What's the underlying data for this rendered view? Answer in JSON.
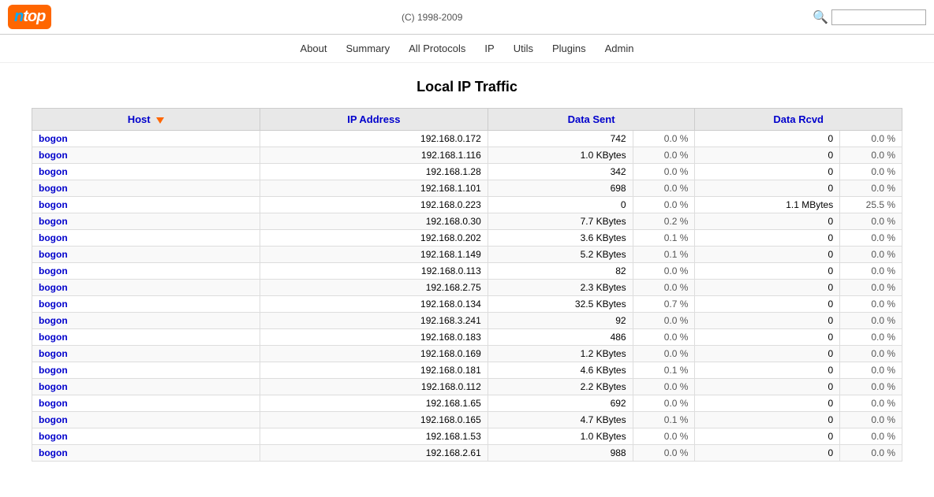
{
  "header": {
    "logo_text": "ntop",
    "copyright": "(C) 1998-2009"
  },
  "nav": {
    "items": [
      {
        "label": "About",
        "id": "about"
      },
      {
        "label": "Summary",
        "id": "summary"
      },
      {
        "label": "All Protocols",
        "id": "all-protocols"
      },
      {
        "label": "IP",
        "id": "ip"
      },
      {
        "label": "Utils",
        "id": "utils"
      },
      {
        "label": "Plugins",
        "id": "plugins"
      },
      {
        "label": "Admin",
        "id": "admin"
      }
    ]
  },
  "page_title": "Local IP Traffic",
  "table": {
    "columns": [
      "Host",
      "IP Address",
      "Data Sent",
      "",
      "Data Rcvd",
      ""
    ],
    "header_row": {
      "host": "Host",
      "ip_address": "IP Address",
      "data_sent": "Data Sent",
      "data_rcvd": "Data Rcvd"
    },
    "rows": [
      {
        "host": "bogon",
        "ip": "192.168.0.172",
        "sent": "742",
        "sent_pct": "0.0 %",
        "rcvd": "0",
        "rcvd_pct": "0.0 %"
      },
      {
        "host": "bogon",
        "ip": "192.168.1.116",
        "sent": "1.0 KBytes",
        "sent_pct": "0.0 %",
        "rcvd": "0",
        "rcvd_pct": "0.0 %"
      },
      {
        "host": "bogon",
        "ip": "192.168.1.28",
        "sent": "342",
        "sent_pct": "0.0 %",
        "rcvd": "0",
        "rcvd_pct": "0.0 %"
      },
      {
        "host": "bogon",
        "ip": "192.168.1.101",
        "sent": "698",
        "sent_pct": "0.0 %",
        "rcvd": "0",
        "rcvd_pct": "0.0 %"
      },
      {
        "host": "bogon",
        "ip": "192.168.0.223",
        "sent": "0",
        "sent_pct": "0.0 %",
        "rcvd": "1.1 MBytes",
        "rcvd_pct": "25.5 %"
      },
      {
        "host": "bogon",
        "ip": "192.168.0.30",
        "sent": "7.7 KBytes",
        "sent_pct": "0.2 %",
        "rcvd": "0",
        "rcvd_pct": "0.0 %"
      },
      {
        "host": "bogon",
        "ip": "192.168.0.202",
        "sent": "3.6 KBytes",
        "sent_pct": "0.1 %",
        "rcvd": "0",
        "rcvd_pct": "0.0 %"
      },
      {
        "host": "bogon",
        "ip": "192.168.1.149",
        "sent": "5.2 KBytes",
        "sent_pct": "0.1 %",
        "rcvd": "0",
        "rcvd_pct": "0.0 %"
      },
      {
        "host": "bogon",
        "ip": "192.168.0.113",
        "sent": "82",
        "sent_pct": "0.0 %",
        "rcvd": "0",
        "rcvd_pct": "0.0 %"
      },
      {
        "host": "bogon",
        "ip": "192.168.2.75",
        "sent": "2.3 KBytes",
        "sent_pct": "0.0 %",
        "rcvd": "0",
        "rcvd_pct": "0.0 %"
      },
      {
        "host": "bogon",
        "ip": "192.168.0.134",
        "sent": "32.5 KBytes",
        "sent_pct": "0.7 %",
        "rcvd": "0",
        "rcvd_pct": "0.0 %"
      },
      {
        "host": "bogon",
        "ip": "192.168.3.241",
        "sent": "92",
        "sent_pct": "0.0 %",
        "rcvd": "0",
        "rcvd_pct": "0.0 %"
      },
      {
        "host": "bogon",
        "ip": "192.168.0.183",
        "sent": "486",
        "sent_pct": "0.0 %",
        "rcvd": "0",
        "rcvd_pct": "0.0 %"
      },
      {
        "host": "bogon",
        "ip": "192.168.0.169",
        "sent": "1.2 KBytes",
        "sent_pct": "0.0 %",
        "rcvd": "0",
        "rcvd_pct": "0.0 %"
      },
      {
        "host": "bogon",
        "ip": "192.168.0.181",
        "sent": "4.6 KBytes",
        "sent_pct": "0.1 %",
        "rcvd": "0",
        "rcvd_pct": "0.0 %"
      },
      {
        "host": "bogon",
        "ip": "192.168.0.112",
        "sent": "2.2 KBytes",
        "sent_pct": "0.0 %",
        "rcvd": "0",
        "rcvd_pct": "0.0 %"
      },
      {
        "host": "bogon",
        "ip": "192.168.1.65",
        "sent": "692",
        "sent_pct": "0.0 %",
        "rcvd": "0",
        "rcvd_pct": "0.0 %"
      },
      {
        "host": "bogon",
        "ip": "192.168.0.165",
        "sent": "4.7 KBytes",
        "sent_pct": "0.1 %",
        "rcvd": "0",
        "rcvd_pct": "0.0 %"
      },
      {
        "host": "bogon",
        "ip": "192.168.1.53",
        "sent": "1.0 KBytes",
        "sent_pct": "0.0 %",
        "rcvd": "0",
        "rcvd_pct": "0.0 %"
      },
      {
        "host": "bogon",
        "ip": "192.168.2.61",
        "sent": "988",
        "sent_pct": "0.0 %",
        "rcvd": "0",
        "rcvd_pct": "0.0 %"
      }
    ]
  },
  "search": {
    "placeholder": ""
  }
}
